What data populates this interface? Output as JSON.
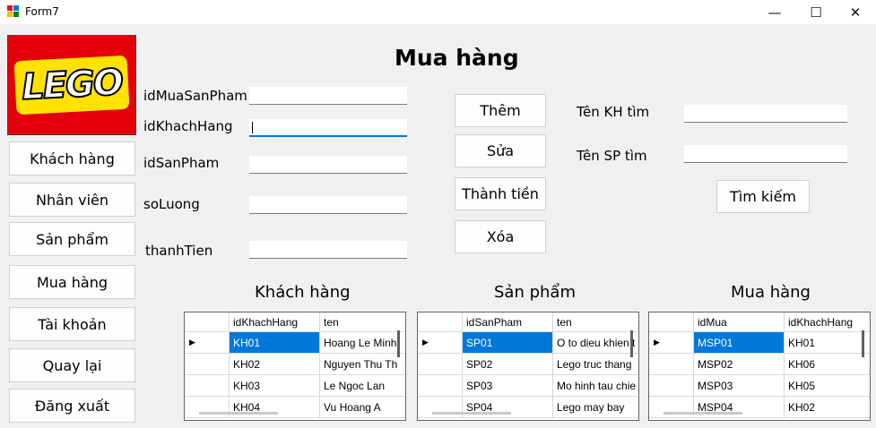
{
  "window": {
    "title": "Form7",
    "minimize_glyph": "—",
    "maximize_glyph": "☐",
    "close_glyph": "✕"
  },
  "logo": {
    "text": "LEGO"
  },
  "nav": {
    "items": [
      {
        "label": "Khách hàng"
      },
      {
        "label": "Nhân viên"
      },
      {
        "label": "Sản phẩm"
      },
      {
        "label": "Mua hàng"
      },
      {
        "label": "Tài khoản"
      },
      {
        "label": "Quay lại"
      },
      {
        "label": "Đăng xuất"
      }
    ]
  },
  "page_title": "Mua hàng",
  "form": {
    "fields": [
      {
        "label": "idMuaSanPham",
        "value": ""
      },
      {
        "label": "idKhachHang",
        "value": ""
      },
      {
        "label": "idSanPham",
        "value": ""
      },
      {
        "label": "soLuong",
        "value": ""
      },
      {
        "label": "thanhTien",
        "value": ""
      }
    ]
  },
  "actions": {
    "add": "Thêm",
    "edit": "Sửa",
    "total": "Thành tiền",
    "delete": "Xóa"
  },
  "search": {
    "customer_label": "Tên KH tìm",
    "customer_value": "",
    "product_label": "Tên SP tìm",
    "product_value": "",
    "button": "Tìm kiếm"
  },
  "sections": {
    "customers": "Khách hàng",
    "products": "Sản phẩm",
    "purchases": "Mua hàng"
  },
  "tables": {
    "customers": {
      "columns": [
        "idKhachHang",
        "ten"
      ],
      "rows": [
        [
          "KH01",
          "Hoang Le Minh"
        ],
        [
          "KH02",
          "Nguyen Thu Th"
        ],
        [
          "KH03",
          "Le Ngoc Lan"
        ],
        [
          "KH04",
          "Vu Hoang A"
        ]
      ]
    },
    "products": {
      "columns": [
        "idSanPham",
        "ten"
      ],
      "rows": [
        [
          "SP01",
          "O to dieu khien t"
        ],
        [
          "SP02",
          "Lego truc thang"
        ],
        [
          "SP03",
          "Mo hinh tau chie"
        ],
        [
          "SP04",
          "Lego may bay"
        ]
      ]
    },
    "purchases": {
      "columns": [
        "idMua",
        "idKhachHang"
      ],
      "rows": [
        [
          "MSP01",
          "KH01"
        ],
        [
          "MSP02",
          "KH06"
        ],
        [
          "MSP03",
          "KH05"
        ],
        [
          "MSP04",
          "KH02"
        ]
      ]
    }
  },
  "colors": {
    "selection": "#0078d7",
    "logo_red": "#e3000b",
    "logo_yellow": "#ffe200"
  }
}
